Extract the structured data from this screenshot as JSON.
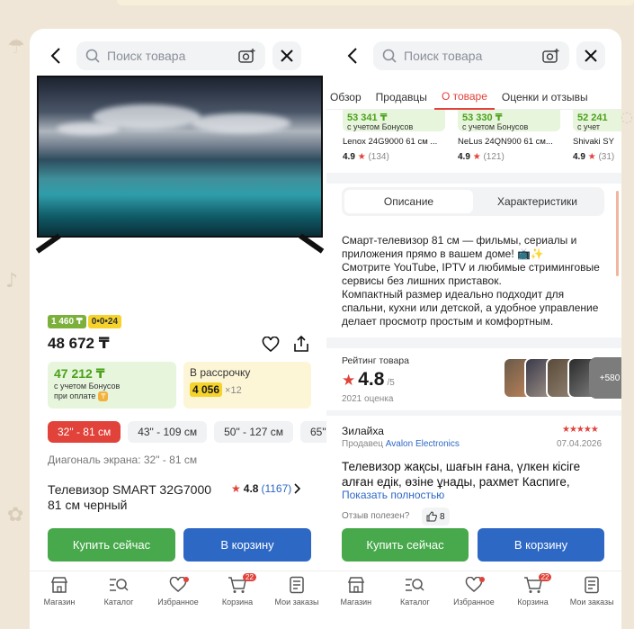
{
  "left": {
    "search_placeholder": "Поиск товара",
    "badge_green": "1 460 ₸",
    "badge_yellow": "0•0•24",
    "price": "48 672 ₸",
    "bonus_price": "47 212 ₸",
    "bonus_note_1": "с учетом Бонусов",
    "bonus_note_2": "при оплате",
    "install_title": "В рассрочку",
    "install_amount": "4 056",
    "install_mult": "×12",
    "sizes": [
      "32\" - 81 см",
      "43\" - 109 см",
      "50\" - 127 см",
      "65\""
    ],
    "diagonal": "Диагональ экрана: 32\" - 81 см",
    "title": "Телевизор SMART 32G7000 81 см черный",
    "rating": "4.8",
    "reviews": "(1167)",
    "buy_now": "Купить сейчас",
    "to_cart": "В корзину"
  },
  "right": {
    "search_placeholder": "Поиск товара",
    "tabs": [
      "Обзор",
      "Продавцы",
      "О товаре",
      "Оценки и отзывы"
    ],
    "similar": [
      {
        "price": "53 341 ₸",
        "note": "с учетом Бонусов",
        "name": "Lenox 24G9000 61 см ...",
        "rating": "4.9",
        "count": "(134)"
      },
      {
        "price": "53 330 ₸",
        "note": "с учетом Бонусов",
        "name": "NeLus 24QN900 61 см...",
        "rating": "4.9",
        "count": "(121)"
      },
      {
        "price": "52 241",
        "note": "с учет",
        "name": "Shivaki SY",
        "rating": "4.9",
        "count": "(31)"
      }
    ],
    "seg_description": "Описание",
    "seg_specs": "Характеристики",
    "description": "Смарт-телевизор 81 см — фильмы, сериалы и приложения прямо в вашем доме! 📺✨\nСмотрите YouTube, IPTV и любимые стриминговые сервисы без лишних приставок.\nКомпактный размер идеально подходит для спальни, кухни или детской, а удобное управление делает просмотр простым и комфортным.",
    "rating_label": "Рейтинг товара",
    "rating_value": "4.8",
    "rating_of": "/5",
    "rating_count": "2021 оценка",
    "more_photos": "+580",
    "review_author": "Зилайха",
    "review_stars": "★★★★★",
    "review_seller_prefix": "Продавец",
    "review_seller": "Avalon Electronics",
    "review_date": "07.04.2026",
    "review_text": "Телевизор жақсы, шағын ғана, үлкен кісіге алған едік, өзіне ұнады, рахмет Каспиге,",
    "review_more": "Показать полностью",
    "helpful_q": "Отзыв полезен?",
    "helpful_count": "8",
    "buy_now": "Купить сейчас",
    "to_cart": "В корзину"
  },
  "nav": {
    "items": [
      "Магазин",
      "Каталог",
      "Избранное",
      "Корзина",
      "Мои заказы"
    ],
    "cart_count": "22"
  },
  "colors": {
    "accent_red": "#e1423a",
    "buy_green": "#47a94b",
    "cart_blue": "#2d68c4",
    "bonus_green": "#4aa11a"
  }
}
